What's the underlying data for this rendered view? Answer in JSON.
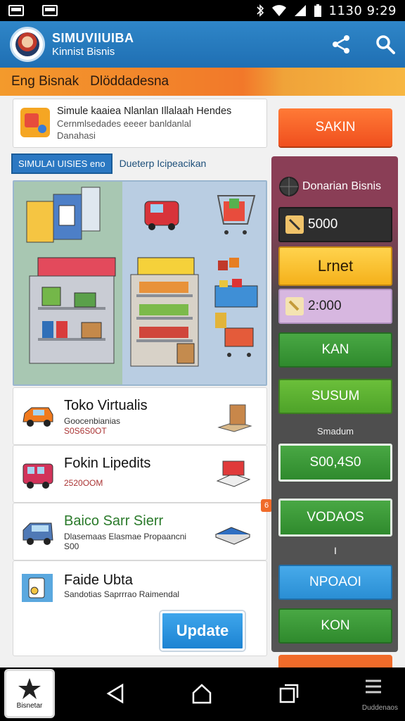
{
  "status_bar": {
    "time": "1130 9:29"
  },
  "app": {
    "title": "SIMUVIIUIBA",
    "subtitle": "Kinnist Bisnis"
  },
  "banner": {
    "left": "Eng Bisnak",
    "right": "Dlöddadesna"
  },
  "top_card": {
    "title": "Simule kaaiea Nlanlan Illalaah Hendes",
    "line2": "Cernmlsedades eeeer banldanlal",
    "line3": "Danahasi"
  },
  "tabs": {
    "active": "SIMULAI UISIES eno",
    "inactive": "Dueterp Icipeacikan"
  },
  "products": [
    {
      "name": "Toko Virtualis",
      "desc": "Goocenbianias",
      "price": "S0S6S0OT"
    },
    {
      "name": "Fokin Lipedits",
      "desc": "",
      "price": "2520OOM"
    },
    {
      "name": "Baico Sarr Sierr",
      "desc": "Dlasemaas Elasmae Propaancni",
      "price": "S00",
      "badge": "6"
    },
    {
      "name": "Faide Ubta",
      "desc": "Sandotias Saprrrao Raimendal",
      "price": ""
    }
  ],
  "update_button": "Update",
  "right_panel": {
    "top_button": "SAKIN",
    "header": "Donarian Bisnis",
    "value1": "5000",
    "yellow_btn": "Lrnet",
    "value2": "2:000",
    "btn_kan": "KAN",
    "btn_susum": "SUSUM",
    "small_label": "Smadum",
    "value3": "S00,4S0",
    "btn_vodaos": "VODAOS",
    "small_mark": "I",
    "btn_npoad": "NPOAOI",
    "btn_kon": "KON"
  },
  "nav": {
    "home_label": "Bisnetar",
    "right_label": "Duddenaos"
  }
}
